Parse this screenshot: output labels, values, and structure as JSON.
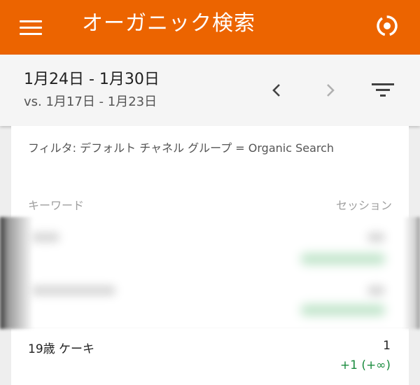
{
  "appbar": {
    "title": "オーガニック検索",
    "menu_icon": "menu-icon",
    "account_icon": "account-switch-icon",
    "color": "#ec6400"
  },
  "dates": {
    "range": "1月24日 - 1月30日",
    "compare": "vs. 1月17日 - 1月23日"
  },
  "filter": {
    "text": "フィルタ: デフォルト チャネル グループ = Organic Search"
  },
  "table": {
    "col_keyword": "キーワード",
    "col_sessions": "セッション",
    "rows": [
      {
        "keyword": "19歳 ケーキ",
        "value": "1",
        "delta": "+1 (+∞)"
      }
    ]
  }
}
